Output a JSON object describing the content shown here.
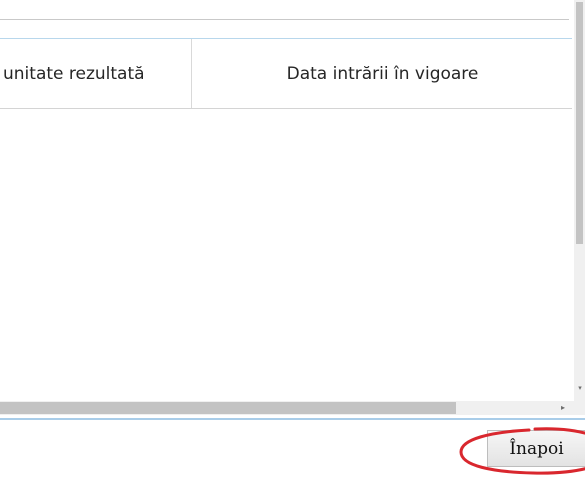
{
  "table": {
    "columns": [
      {
        "label": "unitate rezultată"
      },
      {
        "label": "Data intrării în vigoare"
      }
    ]
  },
  "footer": {
    "back_label": "Înapoi"
  },
  "colors": {
    "accent_border": "#a9cde9",
    "highlight": "#d9272e"
  }
}
